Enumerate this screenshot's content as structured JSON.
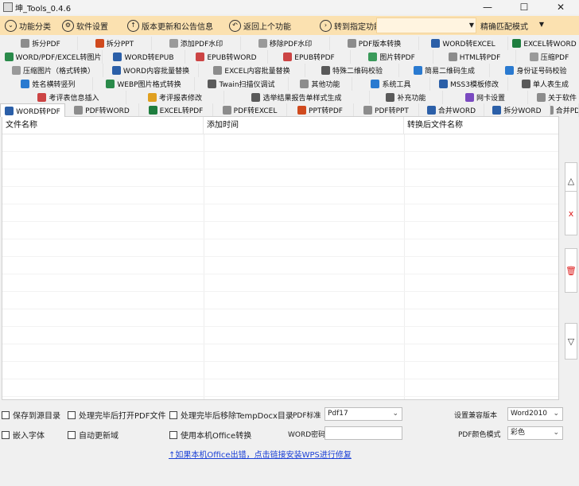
{
  "window": {
    "title": "坤_Tools_0.4.6",
    "minimize": "—",
    "maximize": "☐",
    "close": "✕"
  },
  "toolbar": {
    "items": [
      {
        "label": "功能分类",
        "icon": "chevron-icon",
        "glyph": "⌄"
      },
      {
        "label": "软件设置",
        "icon": "gear-icon",
        "glyph": "⚙"
      },
      {
        "label": "版本更新和公告信息",
        "icon": "arrow-up-circle-icon",
        "glyph": "↑"
      },
      {
        "label": "返回上个功能",
        "icon": "back-arrow-icon",
        "glyph": "↶"
      },
      {
        "label": "转到指定功能",
        "icon": "arrow-right-circle-icon",
        "glyph": "›"
      }
    ],
    "search_value": "",
    "match_mode": "精确匹配模式"
  },
  "tab_rows": [
    [
      {
        "label": "拆分PDF",
        "color": "#8c8c8c"
      },
      {
        "label": "拆分PPT",
        "color": "#d04a1e"
      },
      {
        "label": "添加PDF水印",
        "color": "#9a9a9a"
      },
      {
        "label": "移除PDF水印",
        "color": "#9a9a9a"
      },
      {
        "label": "PDF版本转换",
        "color": "#8c8c8c"
      },
      {
        "label": "WORD转EXCEL",
        "color": "#2b5fa8"
      },
      {
        "label": "EXCEL转WORD",
        "color": "#1e7d3e"
      }
    ],
    [
      {
        "label": "WORD/PDF/EXCEL转图片",
        "color": "#2a8a4a"
      },
      {
        "label": "WORD转EPUB",
        "color": "#2b5fa8"
      },
      {
        "label": "EPUB转WORD",
        "color": "#c44"
      },
      {
        "label": "EPUB转PDF",
        "color": "#c44"
      },
      {
        "label": "图片转PDF",
        "color": "#3a9a5a"
      },
      {
        "label": "HTML转PDF",
        "color": "#8c8c8c"
      },
      {
        "label": "压缩PDF",
        "color": "#9a9a9a"
      }
    ],
    [
      {
        "label": "压缩图片（格式转换）",
        "color": "#9a9a9a"
      },
      {
        "label": "WORD内容批量替换",
        "color": "#2b5fa8"
      },
      {
        "label": "EXCEL内容批量替换",
        "color": "#8c8c8c"
      },
      {
        "label": "特殊二维码校验",
        "color": "#5a5a5a"
      },
      {
        "label": "简易二维码生成",
        "color": "#2a7ad0"
      },
      {
        "label": "身份证号码校验",
        "color": "#2a7ad0"
      }
    ],
    [
      {
        "label": "姓名横转竖列",
        "color": "#2a7ad0"
      },
      {
        "label": "WEBP图片格式转换",
        "color": "#2a8a4a"
      },
      {
        "label": "Twain扫描仪调试",
        "color": "#5a5a5a"
      },
      {
        "label": "其他功能",
        "color": "#8c8c8c"
      },
      {
        "label": "系统工具",
        "color": "#2a7ad0"
      },
      {
        "label": "MSS3模板修改",
        "color": "#2b5fa8"
      },
      {
        "label": "单人表生成",
        "color": "#5a5a5a"
      }
    ],
    [
      {
        "label": "考评表信息插入",
        "color": "#c44"
      },
      {
        "label": "考评报表修改",
        "color": "#e0a020"
      },
      {
        "label": "选举结果报告单样式生成",
        "color": "#5a5a5a"
      },
      {
        "label": "补充功能",
        "color": "#5a5a5a"
      },
      {
        "label": "网卡设置",
        "color": "#7a4ac0"
      },
      {
        "label": "关于软件",
        "color": "#8c8c8c"
      }
    ],
    [
      {
        "label": "WORD转PDF",
        "color": "#2b5fa8"
      },
      {
        "label": "PDF转WORD",
        "color": "#8c8c8c"
      },
      {
        "label": "EXCEL转PDF",
        "color": "#1e7d3e"
      },
      {
        "label": "PDF转EXCEL",
        "color": "#8c8c8c"
      },
      {
        "label": "PPT转PDF",
        "color": "#d04a1e"
      },
      {
        "label": "PDF转PPT",
        "color": "#8c8c8c"
      },
      {
        "label": "合并WORD",
        "color": "#2b5fa8"
      },
      {
        "label": "拆分WORD",
        "color": "#2b5fa8"
      },
      {
        "label": "合并PDF",
        "color": "#8c8c8c"
      }
    ]
  ],
  "grid": {
    "columns": [
      "文件名称",
      "添加时间",
      "转换后文件名称"
    ]
  },
  "side_buttons": [
    {
      "name": "move-up-button",
      "glyph": "△",
      "color": "#333"
    },
    {
      "name": "remove-item-button",
      "glyph": "x",
      "color": "#d22"
    },
    {
      "name": "clear-list-button",
      "glyph": "🗑",
      "color": "#d22"
    },
    {
      "name": "move-down-button",
      "glyph": "▽",
      "color": "#333"
    }
  ],
  "options": {
    "save_to_source_dir": "保存到源目录",
    "open_pdf_after": "处理完毕后打开PDF文件",
    "remove_tempdocx": "处理完毕后移除TempDocx目录",
    "embed_fonts": "嵌入字体",
    "auto_update_fields": "自动更新域",
    "use_local_office": "使用本机Office转换",
    "pdf_standard_label": "PDF标准",
    "pdf_standard_value": "Pdf17",
    "word_password_label": "WORD密码",
    "word_password_value": "",
    "compat_label": "设置兼容版本",
    "compat_value": "Word2010",
    "color_mode_label": "PDF颜色模式",
    "color_mode_value": "彩色",
    "help_link": "↑如果本机Office出错，点击链接安装WPS进行修复"
  }
}
